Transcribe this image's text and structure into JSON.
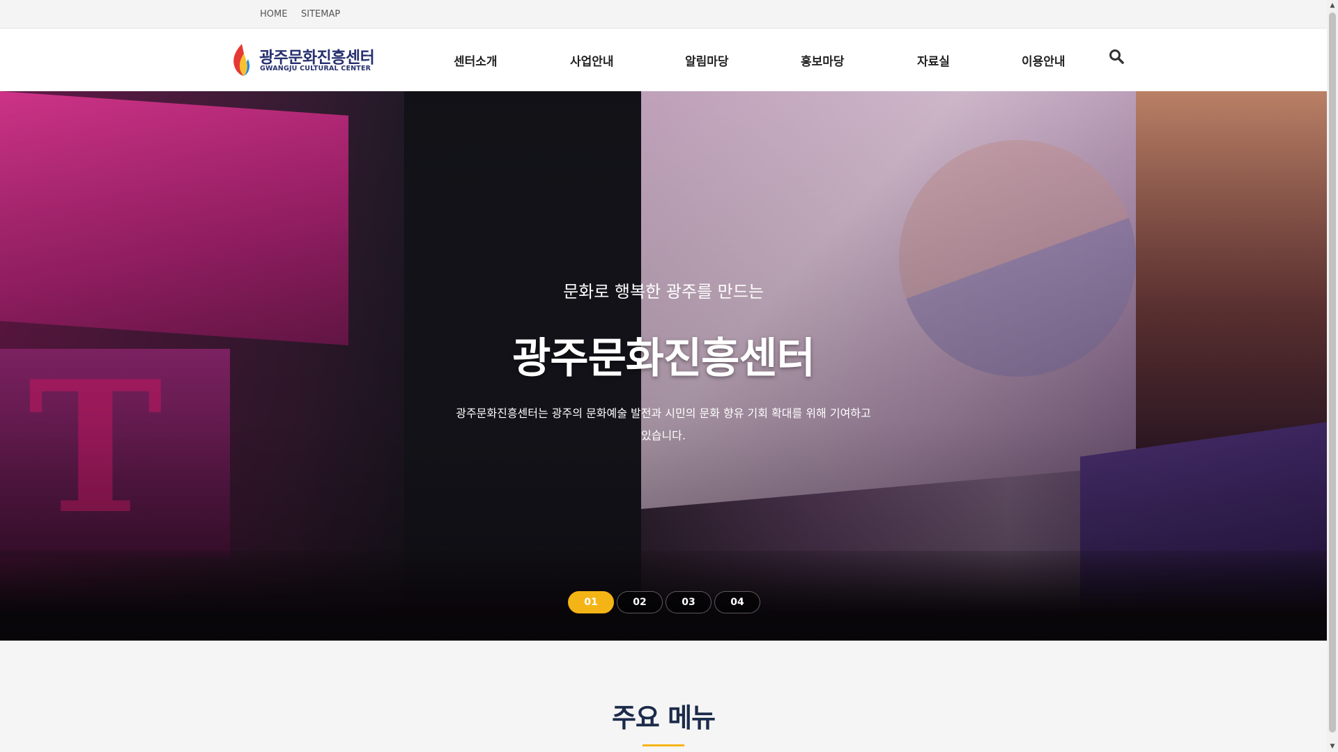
{
  "topbar": {
    "home": "HOME",
    "sitemap": "SITEMAP"
  },
  "logo": {
    "name_ko": "광주문화진흥센터",
    "name_en": "GWANGJU CULTURAL CENTER"
  },
  "nav": {
    "items": [
      "센터소개",
      "사업안내",
      "알림마당",
      "홍보마당",
      "자료실",
      "이용안내"
    ],
    "search_icon": "search-icon"
  },
  "hero": {
    "subtitle": "문화로 행복한 광주를 만드는",
    "title": "광주문화진흥센터",
    "description": "광주문화진흥센터는 광주의 문화예술 발전과 시민의 문화 향유 기회 확대를 위해 기여하고 있습니다.",
    "slides": [
      "01",
      "02",
      "03",
      "04"
    ],
    "active_slide": "01"
  },
  "section": {
    "title": "주요 메뉴"
  },
  "colors": {
    "accent": "#f5b416",
    "brand_navy": "#27306f",
    "heading": "#1c2b4a"
  }
}
